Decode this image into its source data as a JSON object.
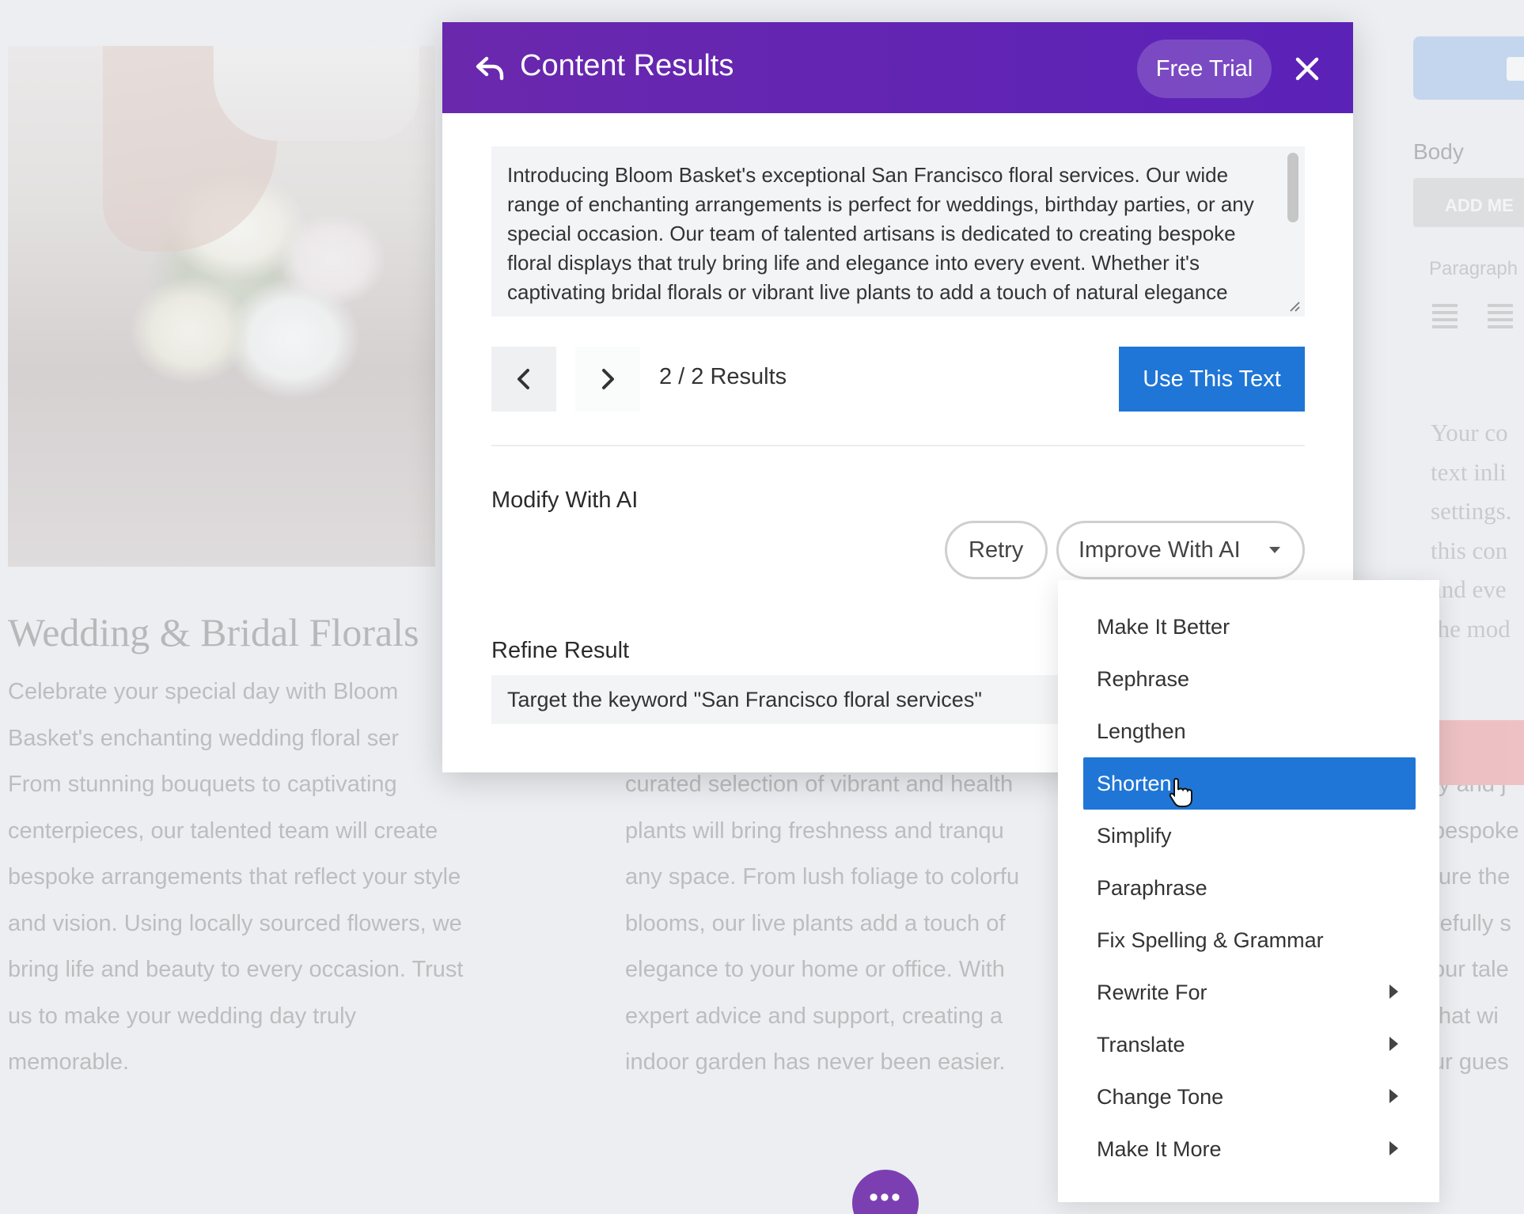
{
  "modal": {
    "title": "Content Results",
    "free_trial_label": "Free Trial",
    "result_text": "Introducing Bloom Basket's exceptional San Francisco floral services. Our wide range of enchanting arrangements is perfect for weddings, birthday parties, or any special occasion. Our team of talented artisans is dedicated to creating bespoke floral displays that truly bring life and elegance into every event. Whether it's captivating bridal florals or vibrant live plants to add a touch of natural elegance",
    "results_counter": "2 / 2 Results",
    "use_text_label": "Use This Text",
    "modify_label": "Modify With AI",
    "retry_label": "Retry",
    "improve_label": "Improve With AI",
    "refine_label": "Refine Result",
    "refine_value": "Target the keyword \"San Francisco floral services\""
  },
  "menu": {
    "items": [
      {
        "label": "Make It Better",
        "submenu": false
      },
      {
        "label": "Rephrase",
        "submenu": false
      },
      {
        "label": "Lengthen",
        "submenu": false
      },
      {
        "label": "Shorten",
        "submenu": false,
        "active": true
      },
      {
        "label": "Simplify",
        "submenu": false
      },
      {
        "label": "Paraphrase",
        "submenu": false
      },
      {
        "label": "Fix Spelling & Grammar",
        "submenu": false
      },
      {
        "label": "Rewrite For",
        "submenu": true
      },
      {
        "label": "Translate",
        "submenu": true
      },
      {
        "label": "Change Tone",
        "submenu": true
      },
      {
        "label": "Make It More",
        "submenu": true
      }
    ]
  },
  "background": {
    "heading": "Wedding & Bridal Florals",
    "para1_lines": [
      "Celebrate your special day with Bloom",
      "Basket's enchanting wedding floral ser",
      "From stunning bouquets to captivating",
      "centerpieces, our talented team will create",
      "bespoke arrangements that reflect your style",
      "and vision. Using locally sourced flowers, we",
      "bring life and beauty to every occasion. Trust",
      "us to make your wedding day truly",
      "memorable."
    ],
    "para2_lines": [
      "curated selection of vibrant and health",
      "plants will bring freshness and tranqu",
      "any space. From lush foliage to colorfu",
      "blooms, our live plants add a touch of",
      "elegance to your home or office. With",
      "expert advice and support, creating a",
      "indoor garden has never been easier."
    ],
    "para3_lines": [
      "ty and j",
      "bespoke",
      "ture the",
      "refully s",
      "our tale",
      "that wi",
      "ur gues"
    ],
    "body_label": "Body",
    "add_media_label": "ADD ME",
    "paragraph_label": "Paragraph",
    "side_text_lines": [
      "Your co",
      "text inli",
      "settings.",
      "this con",
      "and eve",
      "the mod"
    ],
    "dots_label": "•••"
  },
  "colors": {
    "header": "#6a28ad",
    "primary_button": "#1f76d6",
    "menu_active": "#1f76d6"
  }
}
